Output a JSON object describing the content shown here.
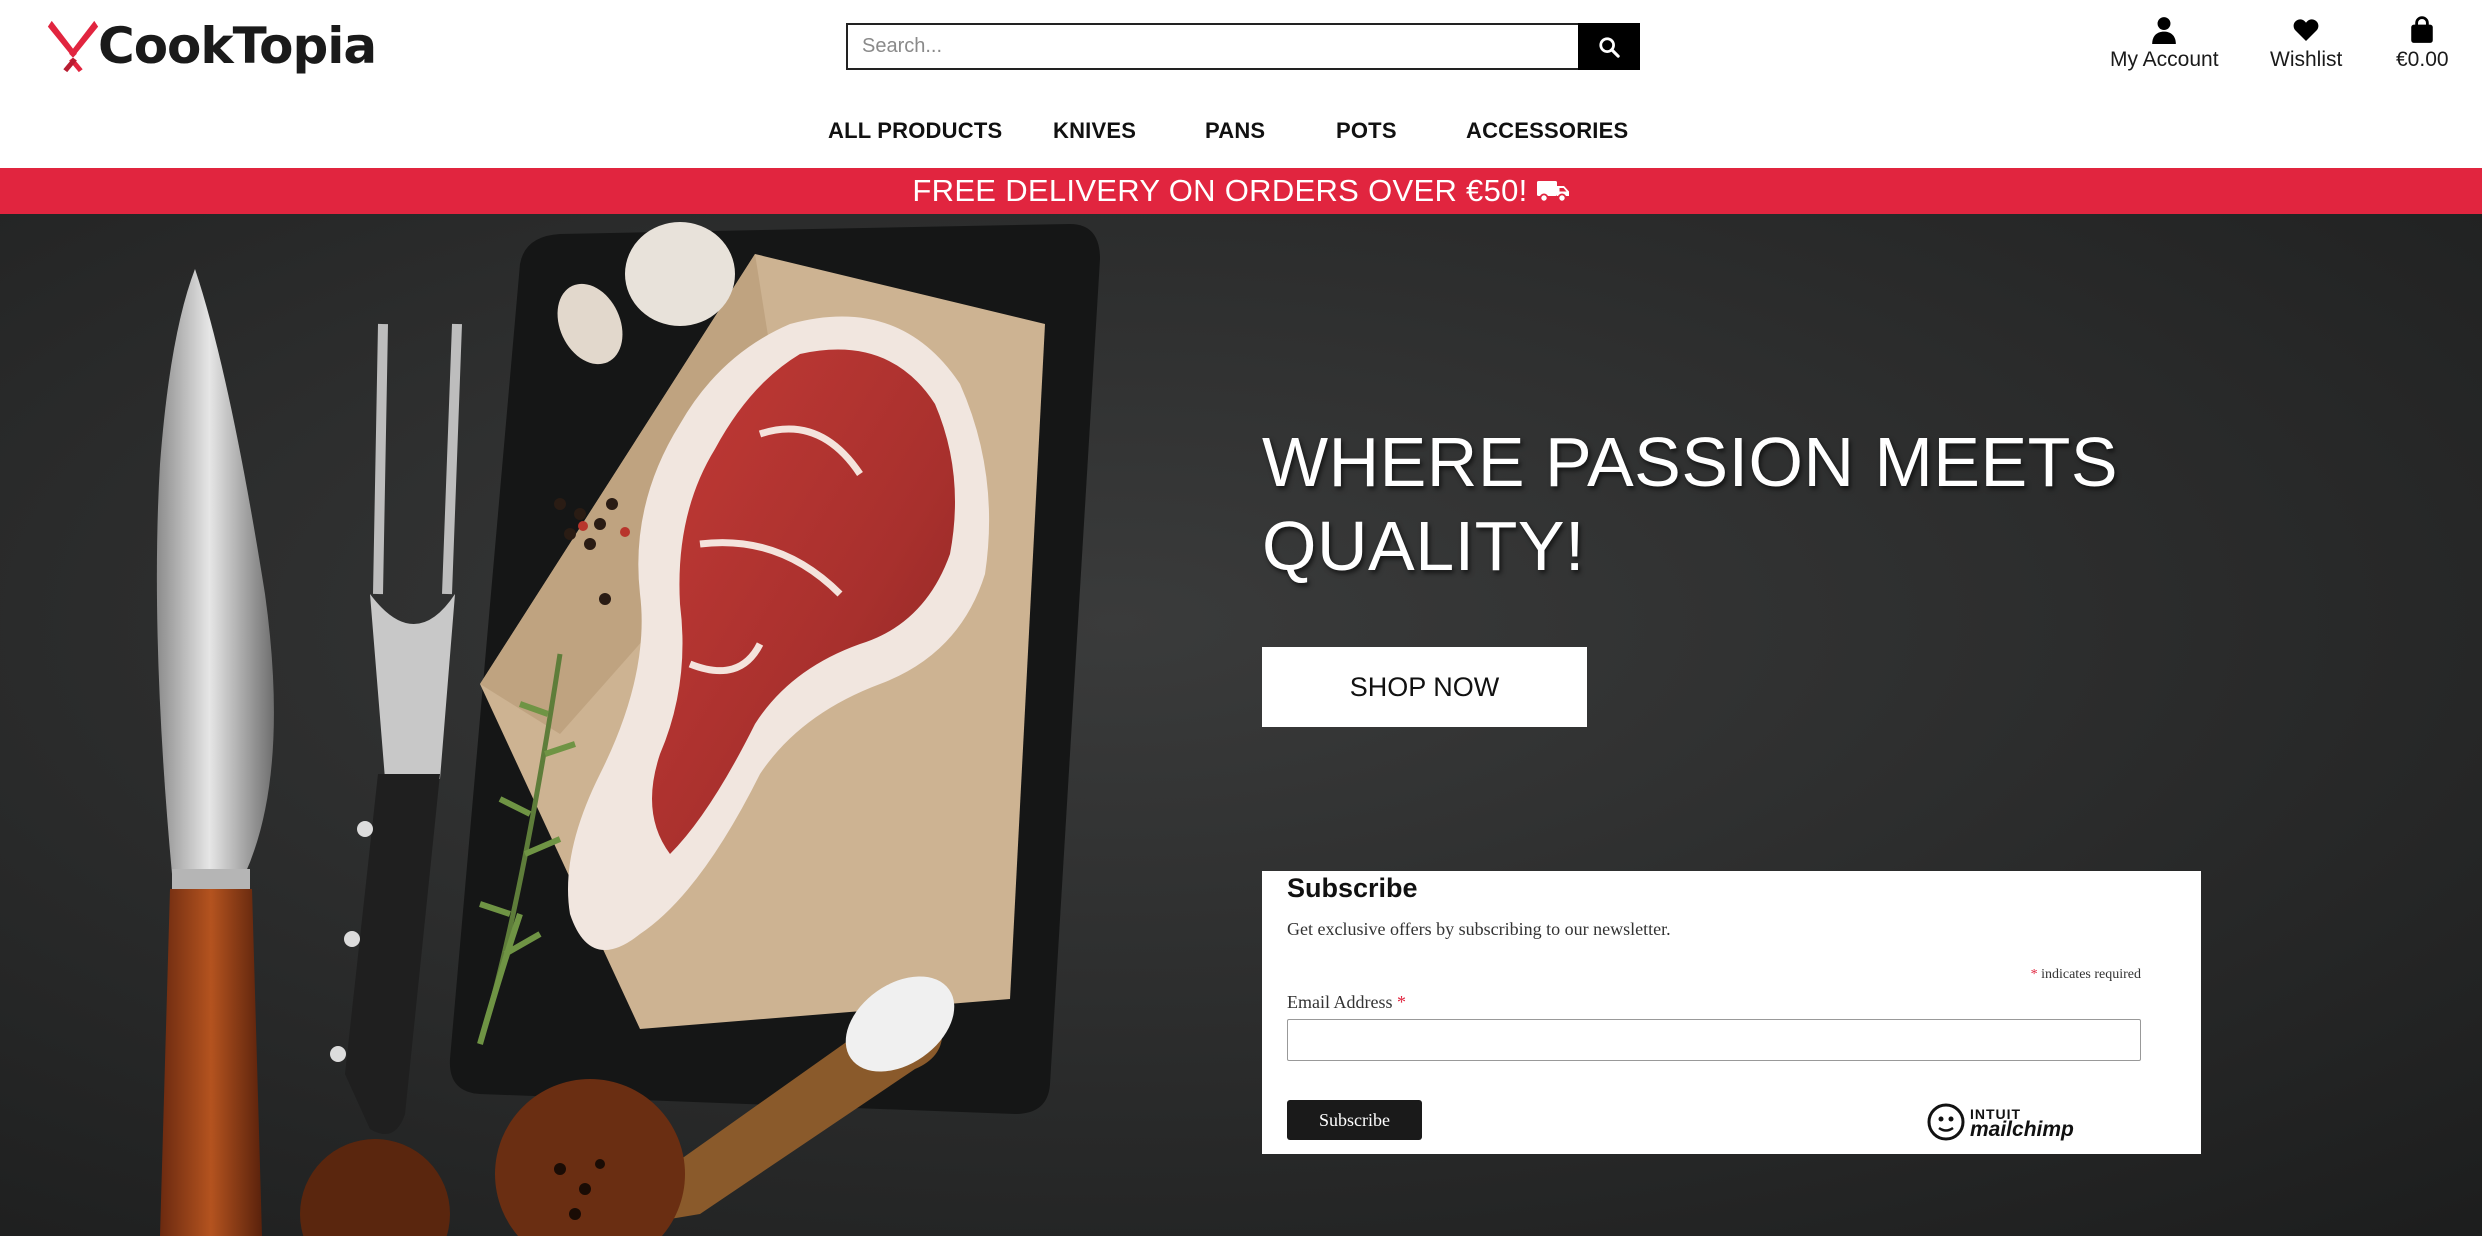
{
  "brand": {
    "name": "CookTopia",
    "logo_icon": "crossed-knives-logo",
    "accent": "#e1253f"
  },
  "search": {
    "placeholder": "Search...",
    "value": "",
    "icon": "search-icon"
  },
  "utilities": {
    "account_label": "My Account",
    "wishlist_label": "Wishlist",
    "bag_total": "€0.00"
  },
  "nav": {
    "items": [
      {
        "label": "ALL PRODUCTS"
      },
      {
        "label": "KNIVES"
      },
      {
        "label": "PANS"
      },
      {
        "label": "POTS"
      },
      {
        "label": "ACCESSORIES"
      }
    ]
  },
  "banner": {
    "text": "FREE DELIVERY ON ORDERS OVER €50!",
    "icon": "truck-icon",
    "color": "#e1253f"
  },
  "hero": {
    "title": "WHERE PASSION MEETS QUALITY!",
    "cta_label": "SHOP NOW",
    "image_desc_icon": "steak-cutting-board-photo"
  },
  "subscribe": {
    "title": "Subscribe",
    "description": "Get exclusive offers by subscribing to our newsletter.",
    "required_marker": "*",
    "required_note": " indicates required",
    "email_label": "Email Address",
    "email_value": "",
    "button_label": "Subscribe",
    "badge_intuit": "INTUIT",
    "badge_name": "mailchimp"
  }
}
